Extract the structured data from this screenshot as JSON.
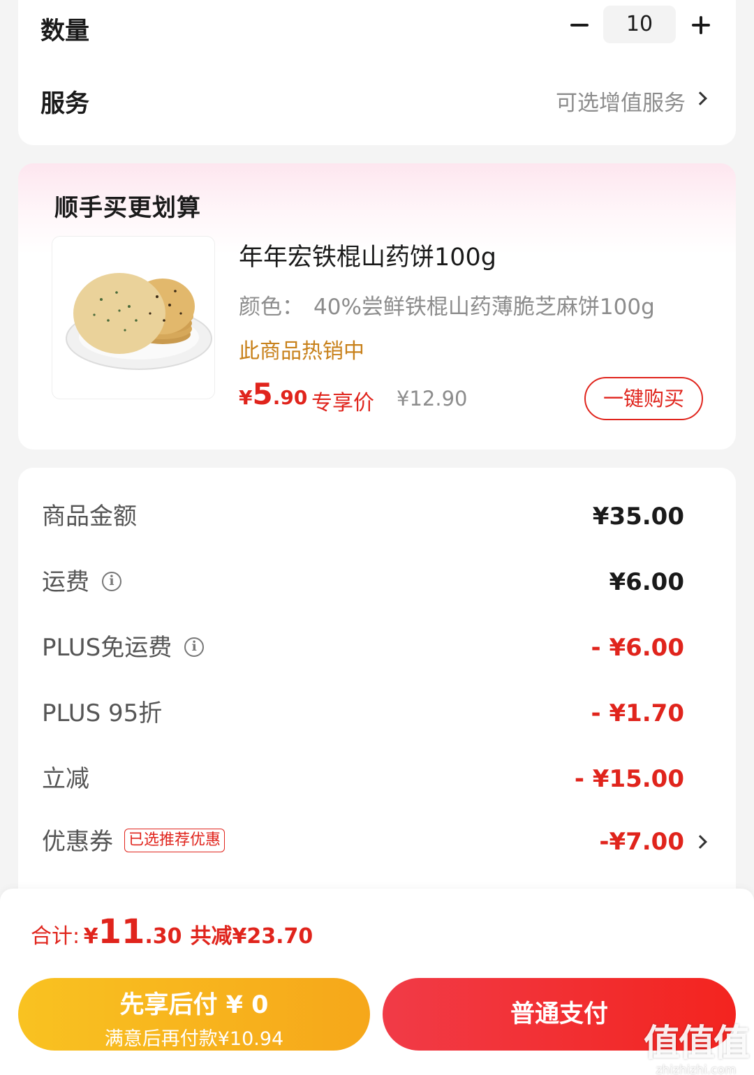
{
  "quantity": {
    "label": "数量",
    "value": "10",
    "minus_icon": "minus-icon",
    "plus_icon": "plus-icon"
  },
  "service": {
    "label": "服务",
    "hint": "可选增值服务"
  },
  "addon": {
    "title": "顺手买更划算",
    "product_name": "年年宏铁棍山药饼100g",
    "spec_label": "颜色：",
    "spec_value": "40%尝鲜铁棍山药薄脆芝麻饼100g",
    "hot_text": "此商品热销中",
    "price_symbol": "¥",
    "price_int": "5",
    "price_dec": ".90",
    "price_tag": "专享价",
    "original_price": "¥12.90",
    "buy_button": "一键购买"
  },
  "fees": [
    {
      "label": "商品金额",
      "value": "¥35.00",
      "color": "#1a1a1a",
      "info": false
    },
    {
      "label": "运费",
      "value": "¥6.00",
      "color": "#1a1a1a",
      "info": true
    },
    {
      "label": "PLUS免运费",
      "value": "- ¥6.00",
      "color": "#e0241c",
      "info": true
    },
    {
      "label": "PLUS 95折",
      "value": "- ¥1.70",
      "color": "#e0241c",
      "info": false
    },
    {
      "label": "立减",
      "value": "- ¥15.00",
      "color": "#e0241c",
      "info": false
    },
    {
      "label": "优惠券",
      "value": "-¥7.00",
      "color": "#e0241c",
      "info": false,
      "tag": "已选推荐优惠"
    }
  ],
  "total": {
    "label": "合计:",
    "symbol": "¥",
    "int": "11",
    "dec": ".30",
    "saved": "共减¥23.70"
  },
  "actions": {
    "pay_later_main": "先享后付 ¥ 0",
    "pay_later_sub": "满意后再付款¥10.94",
    "normal_pay": "普通支付"
  },
  "watermark": {
    "logo": "值值值",
    "url": "zhizhizhi.com"
  },
  "colors": {
    "accent_red": "#e0241c",
    "hot_orange": "#c8811b",
    "pay_later_yellow": "#f9c221",
    "pay_red": "#f13b47"
  }
}
